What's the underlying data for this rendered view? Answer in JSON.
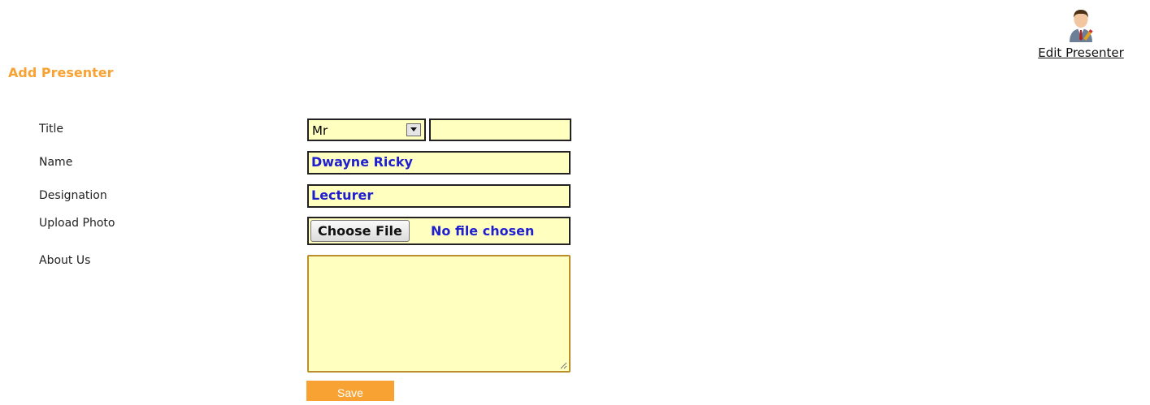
{
  "header": {
    "edit_link_label": "Edit Presenter",
    "edit_icon": "presenter-edit-icon"
  },
  "page_title": "Add Presenter",
  "form": {
    "labels": {
      "title": "Title",
      "name": "Name",
      "designation": "Designation",
      "upload_photo": "Upload Photo",
      "about_us": "About Us"
    },
    "title_select_value": "Mr",
    "title_extra_value": "",
    "name_value": "Dwayne Ricky",
    "designation_value": "Lecturer",
    "file_button_label": "Choose File",
    "file_status": "No file chosen",
    "about_value": "",
    "save_label": "Save"
  },
  "colors": {
    "accent": "#f7a233",
    "field_bg": "#ffffc0",
    "value_text": "#1f1fd0"
  }
}
